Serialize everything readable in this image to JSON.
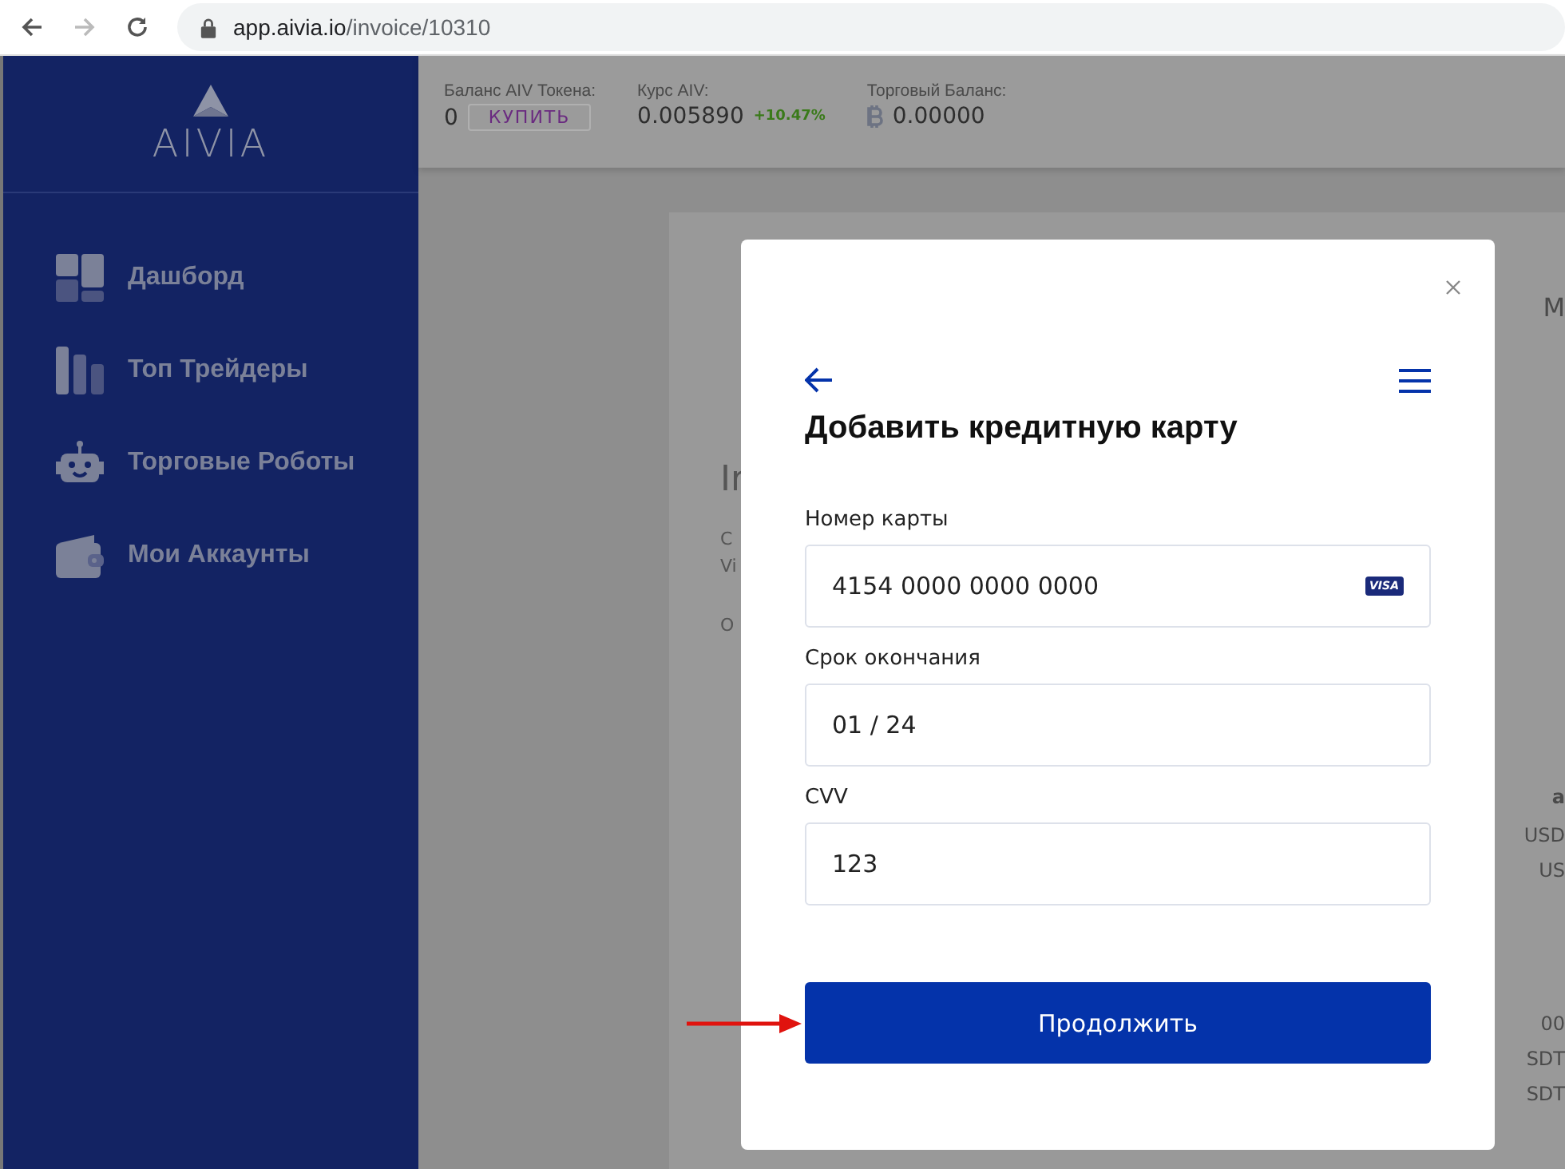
{
  "browser": {
    "url_host": "app.aivia.io",
    "url_path": "/invoice/10310"
  },
  "sidebar": {
    "logo": "AIVIA",
    "items": [
      {
        "label": "Дашборд",
        "kind": "dashboard"
      },
      {
        "label": "Топ Трейдеры",
        "kind": "traders"
      },
      {
        "label": "Торговые Роботы",
        "kind": "robots"
      },
      {
        "label": "Мои Аккаунты",
        "kind": "accounts"
      }
    ]
  },
  "top_bar": {
    "token_balance": {
      "label": "Баланс AIV Токена:",
      "value": "0",
      "button": "КУПИТЬ"
    },
    "rate": {
      "label": "Курс AIV:",
      "value": "0.005890",
      "change": "+10.47%"
    },
    "trade_balance": {
      "label": "Торговый Баланс:",
      "value": "0.00000"
    }
  },
  "background_card": {
    "left_fragments": [
      "Ir",
      "C",
      "Vi",
      "O"
    ],
    "right_fragments": [
      "M",
      "a",
      "USD",
      "US",
      "00",
      "SDT",
      "SDT"
    ]
  },
  "modal": {
    "title": "Добавить кредитную карту",
    "fields": [
      {
        "label": "Номер карты",
        "value": "4154 0000 0000 0000",
        "kind": "card"
      },
      {
        "label": "Срок окончания",
        "value": "01 / 24",
        "kind": "plain"
      },
      {
        "label": "CVV",
        "value": "123",
        "kind": "plain"
      }
    ],
    "card_brand": "VISA",
    "submit": "Продолжить"
  }
}
